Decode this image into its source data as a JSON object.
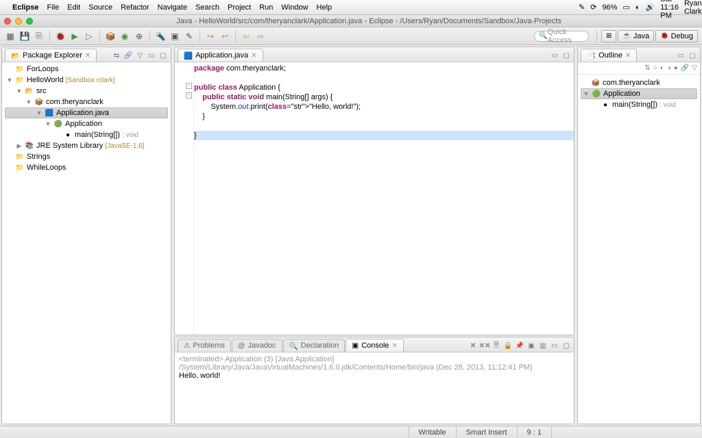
{
  "menubar": {
    "app": "Eclipse",
    "items": [
      "File",
      "Edit",
      "Source",
      "Refactor",
      "Navigate",
      "Search",
      "Project",
      "Run",
      "Window",
      "Help"
    ],
    "right": {
      "battery": "96%",
      "clock": "Sat 11:16 PM",
      "user": "Ryan Clark"
    }
  },
  "window": {
    "title": "Java - HelloWorld/src/com/theryanclark/Application.java - Eclipse - /Users/Ryan/Documents/Sandbox/Java-Projects"
  },
  "quick_access": {
    "placeholder": "Quick Access"
  },
  "perspectives": [
    {
      "label": "Java"
    },
    {
      "label": "Debug"
    }
  ],
  "package_explorer": {
    "title": "Package Explorer",
    "items": [
      {
        "indent": 0,
        "toggle": "",
        "icon": "📁",
        "label": "ForLoops"
      },
      {
        "indent": 0,
        "toggle": "▼",
        "icon": "📁",
        "label": "HelloWorld",
        "anno": "[Sandbox rclark]"
      },
      {
        "indent": 1,
        "toggle": "▼",
        "icon": "📂",
        "label": "src"
      },
      {
        "indent": 2,
        "toggle": "▼",
        "icon": "📦",
        "label": "com.theryanclark"
      },
      {
        "indent": 3,
        "toggle": "▼",
        "icon": "🟦",
        "label": "Application.java",
        "sel": true
      },
      {
        "indent": 4,
        "toggle": "▼",
        "icon": "🟢",
        "label": "Application"
      },
      {
        "indent": 5,
        "toggle": "",
        "icon": "●",
        "label": "main(String[])",
        "void": ": void"
      },
      {
        "indent": 1,
        "toggle": "▶",
        "icon": "📚",
        "label": "JRE System Library",
        "anno": "[JavaSE-1.6]"
      },
      {
        "indent": 0,
        "toggle": "",
        "icon": "📁",
        "label": "Strings"
      },
      {
        "indent": 0,
        "toggle": "",
        "icon": "📁",
        "label": "WhileLoops"
      }
    ]
  },
  "editor": {
    "tab": "Application.java",
    "code_lines": [
      {
        "t": "package com.theryanclark;",
        "cls": ""
      },
      {
        "t": "",
        "cls": ""
      },
      {
        "t": "public class Application {",
        "cls": ""
      },
      {
        "t": "    public static void main(String[] args) {",
        "cls": ""
      },
      {
        "t": "        System.out.print(\"Hello, world!\");",
        "cls": ""
      },
      {
        "t": "    }",
        "cls": ""
      },
      {
        "t": "",
        "cls": ""
      },
      {
        "t": "}",
        "cls": "hl"
      }
    ]
  },
  "outline": {
    "title": "Outline",
    "items": [
      {
        "indent": 0,
        "icon": "📦",
        "label": "com.theryanclark"
      },
      {
        "indent": 0,
        "icon": "🟢",
        "label": "Application",
        "sel": true,
        "toggle": "▼"
      },
      {
        "indent": 1,
        "icon": "●",
        "label": "main(String[])",
        "void": ": void"
      }
    ]
  },
  "bottom": {
    "tabs": [
      "Problems",
      "Javadoc",
      "Declaration",
      "Console"
    ],
    "active": 3,
    "term": "<terminated> Application (3) [Java Application] /System/Library/Java/JavaVirtualMachines/1.6.0.jdk/Contents/Home/bin/java (Dec 28, 2013, 11:12:41 PM)",
    "output": "Hello, world!"
  },
  "status": {
    "writable": "Writable",
    "insert": "Smart Insert",
    "pos": "9 : 1"
  }
}
